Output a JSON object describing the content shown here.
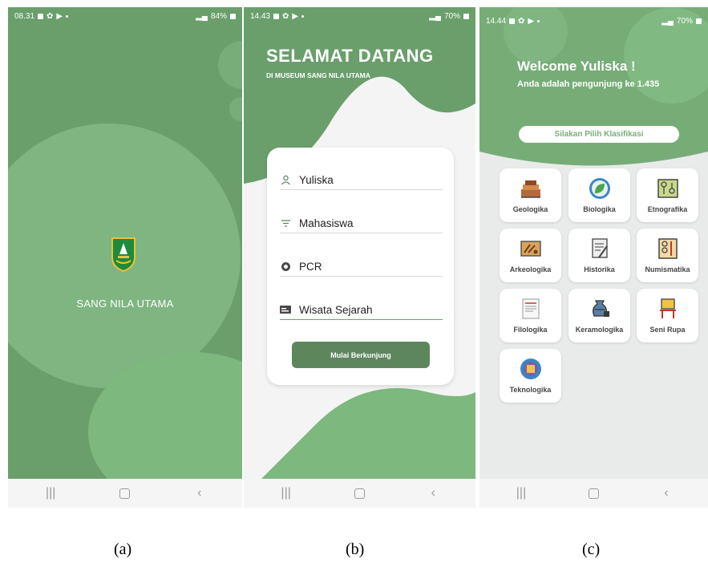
{
  "screen_a": {
    "status_time": "08.31",
    "status_battery": "84%",
    "app_name": "SANG NILA UTAMA",
    "caption": "(a)"
  },
  "screen_b": {
    "status_time": "14.43",
    "status_battery": "70%",
    "title": "SELAMAT DATANG",
    "subtitle": "DI MUSEUM SANG NILA UTAMA",
    "fields": [
      {
        "value": "Yuliska",
        "icon": "person-icon"
      },
      {
        "value": "Mahasiswa",
        "icon": "filter-lines-icon"
      },
      {
        "value": "PCR",
        "icon": "radio-circle-icon"
      },
      {
        "value": "Wisata Sejarah",
        "icon": "card-icon"
      }
    ],
    "submit_label": "Mulai Berkunjung",
    "caption": "(b)"
  },
  "screen_c": {
    "status_time": "14.44",
    "status_battery": "70%",
    "welcome": "Welcome Yuliska !",
    "visitor_text": "Anda adalah pengunjung ke 1.435",
    "classification_button": "Silakan Pilih Klasifikasi",
    "categories": [
      {
        "label": "Geologika",
        "icon": "rock-layers-icon"
      },
      {
        "label": "Biologika",
        "icon": "leaf-icon"
      },
      {
        "label": "Etnografika",
        "icon": "map-icon"
      },
      {
        "label": "Arkeologika",
        "icon": "excavation-icon"
      },
      {
        "label": "Historika",
        "icon": "scroll-icon"
      },
      {
        "label": "Numismatika",
        "icon": "coin-book-icon"
      },
      {
        "label": "Filologika",
        "icon": "manuscript-icon"
      },
      {
        "label": "Keramologika",
        "icon": "pottery-icon"
      },
      {
        "label": "Seni Rupa",
        "icon": "easel-icon"
      },
      {
        "label": "Teknologika",
        "icon": "technology-icon"
      }
    ],
    "caption": "(c)"
  },
  "colors": {
    "primary_green": "#6a9f6b",
    "light_green": "#7db87e",
    "button_green": "#5d865c"
  }
}
